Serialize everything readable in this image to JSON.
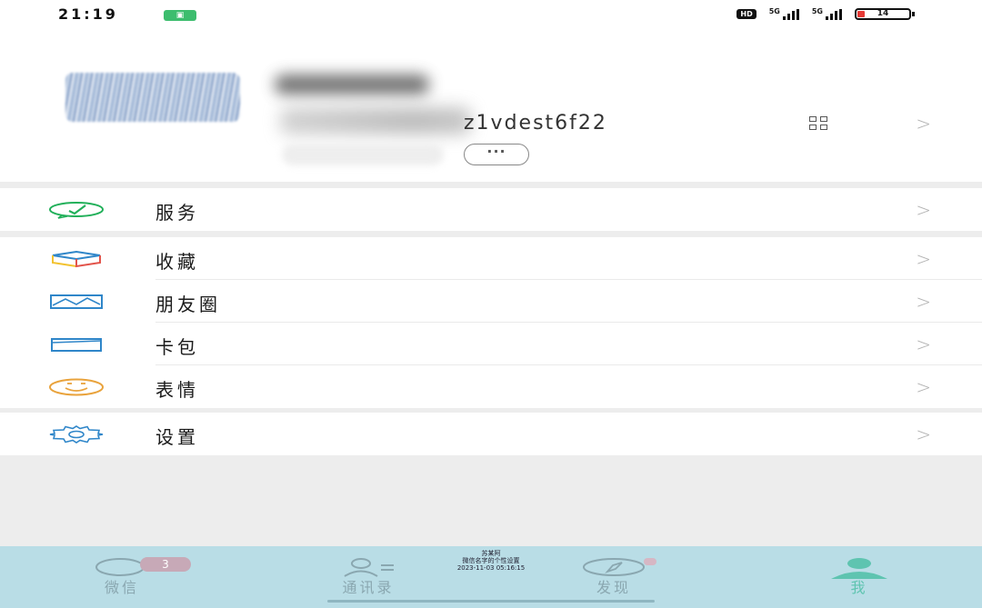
{
  "status_bar": {
    "time": "21:19",
    "network_badge": "HD",
    "signal_1_label": "5G",
    "signal_2_label": "5G",
    "battery_level": "14"
  },
  "profile": {
    "wechat_id": "z1vdest6f22",
    "more_label": "···"
  },
  "menu": {
    "service": "服务",
    "favorites": "收藏",
    "moments": "朋友圈",
    "cards": "卡包",
    "stickers": "表情",
    "settings": "设置",
    "chevron": ">"
  },
  "tabbar": {
    "chats": "微信",
    "chats_badge": "3",
    "contacts": "通讯录",
    "discover": "发现",
    "me": "我",
    "watermark_line1": "苏某阿",
    "watermark_line2": "微信名字的个性设置",
    "watermark_line3": "2023-11-03 05:16:15"
  },
  "colors": {
    "service_icon": "#22b05a",
    "moments_icon": "#2f86c9",
    "stickers_icon": "#e9a33d",
    "settings_icon": "#2f86c9",
    "tab_active": "#5ec4b0",
    "tabbar_bg": "#b9dde6"
  }
}
